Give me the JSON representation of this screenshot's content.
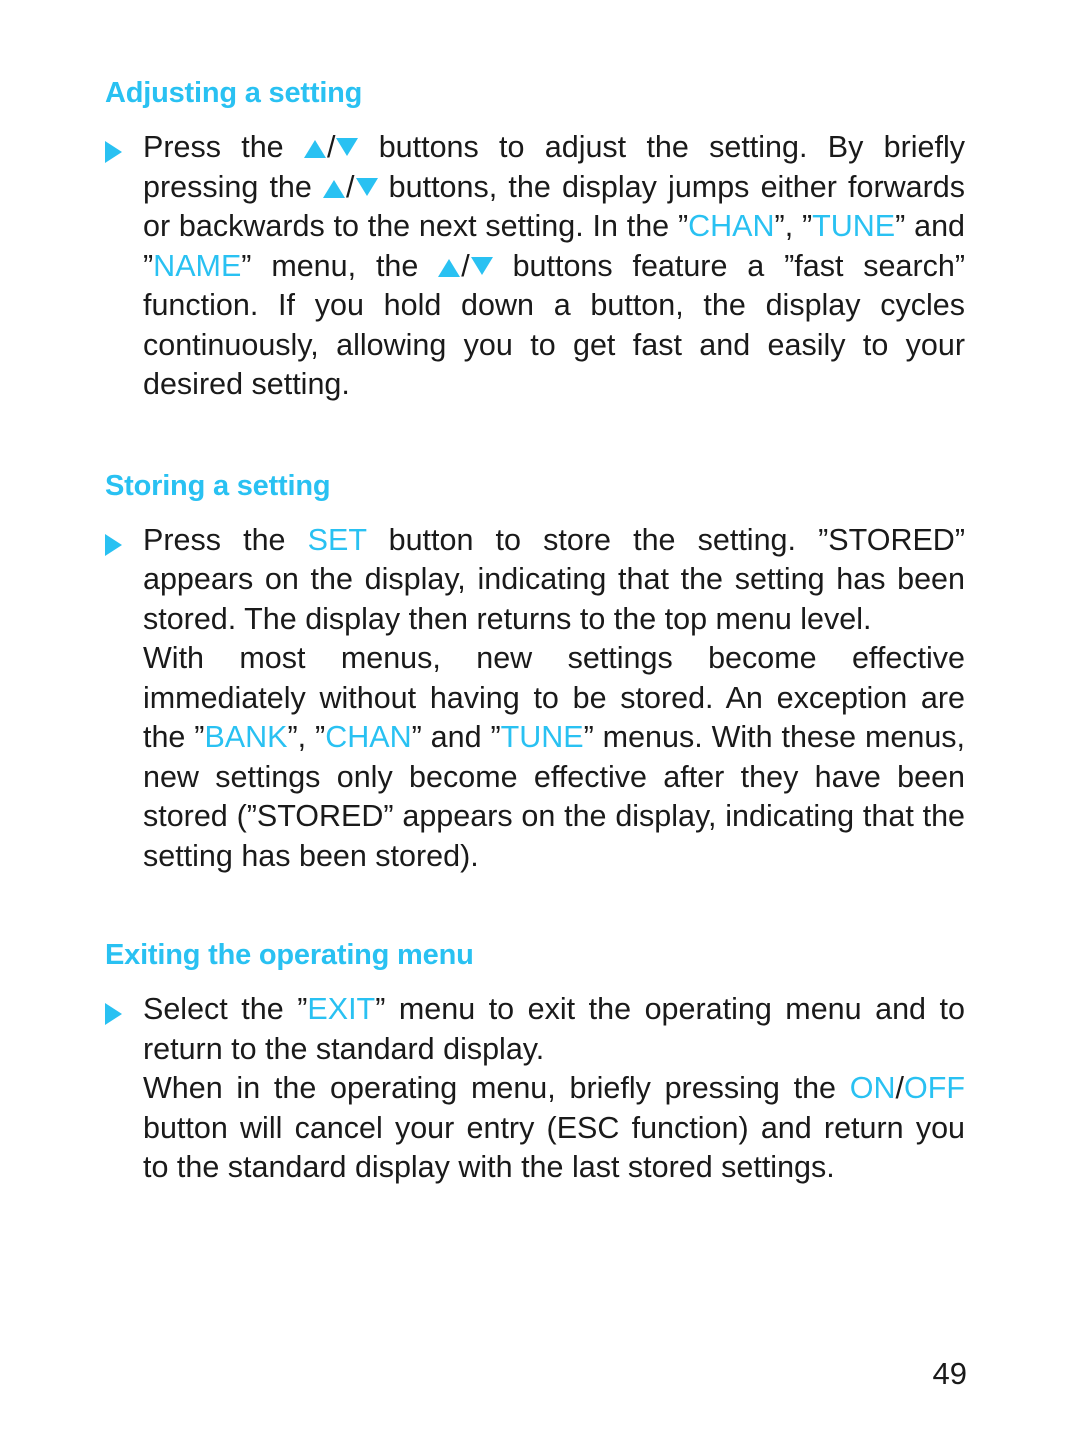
{
  "page": {
    "number": "49",
    "background_color": "#ffffff",
    "accent_color": "#29c1f2",
    "text_color": "#1a1a1a"
  },
  "icons": {
    "bullet": "triangle-right-icon",
    "up_button": "triangle-up-icon",
    "down_button": "triangle-down-icon",
    "separator": "/"
  },
  "sections": [
    {
      "id": "adjusting-a-setting",
      "heading": "Adjusting a setting",
      "paragraphs": [
        {
          "bulleted": true,
          "runs": [
            {
              "text": "Press the ",
              "accent": false
            },
            {
              "text": "UPDOWN",
              "accent": false,
              "glyph": "updown"
            },
            {
              "text": " buttons to adjust the setting. By briefly pressing the ",
              "accent": false
            },
            {
              "text": "UPDOWN",
              "accent": false,
              "glyph": "updown"
            },
            {
              "text": " buttons, the display jumps either forwards or backwards to the next setting. In the ”",
              "accent": false
            },
            {
              "text": "CHAN",
              "accent": true
            },
            {
              "text": "”, ”",
              "accent": false
            },
            {
              "text": "TUNE",
              "accent": true
            },
            {
              "text": "” and ”",
              "accent": false
            },
            {
              "text": "NAME",
              "accent": true
            },
            {
              "text": "” menu, the ",
              "accent": false
            },
            {
              "text": "UPDOWN",
              "accent": false,
              "glyph": "updown"
            },
            {
              "text": " buttons feature a ”fast search” function. If you hold down a button, the display cycles continuously, allowing you to get fast and easily to your desired setting.",
              "accent": false
            }
          ]
        }
      ]
    },
    {
      "id": "storing-a-setting",
      "heading": "Storing a setting",
      "paragraphs": [
        {
          "bulleted": true,
          "runs": [
            {
              "text": "Press the ",
              "accent": false
            },
            {
              "text": "SET",
              "accent": true
            },
            {
              "text": " button to store the setting. ”STORED” appears on the display, indicating that the setting has been stored. The display then returns to the top menu level.",
              "accent": false
            }
          ]
        },
        {
          "bulleted": false,
          "runs": [
            {
              "text": "With most menus, new settings become effective immediately without having to be stored. An exception are the ”",
              "accent": false
            },
            {
              "text": "BANK",
              "accent": true
            },
            {
              "text": "”, ”",
              "accent": false
            },
            {
              "text": "CHAN",
              "accent": true
            },
            {
              "text": "” and ”",
              "accent": false
            },
            {
              "text": "TUNE",
              "accent": true
            },
            {
              "text": "” menus. With these menus, new settings only become effective after they have been stored (”STORED” appears on the display, indicating that the setting has been stored).",
              "accent": false
            }
          ]
        }
      ]
    },
    {
      "id": "exiting-the-operating-menu",
      "heading": "Exiting the operating menu",
      "paragraphs": [
        {
          "bulleted": true,
          "runs": [
            {
              "text": "Select the ”",
              "accent": false
            },
            {
              "text": "EXIT",
              "accent": true
            },
            {
              "text": "” menu to exit the operating menu and to return to the standard display.",
              "accent": false
            }
          ]
        },
        {
          "bulleted": false,
          "runs": [
            {
              "text": "When in the operating menu, briefly pressing the ",
              "accent": false
            },
            {
              "text": "ON",
              "accent": true
            },
            {
              "text": "/",
              "accent": false
            },
            {
              "text": "OFF",
              "accent": true
            },
            {
              "text": " button will cancel your entry (ESC function) and return you to the standard display with the last stored settings.",
              "accent": false
            }
          ]
        }
      ]
    }
  ]
}
